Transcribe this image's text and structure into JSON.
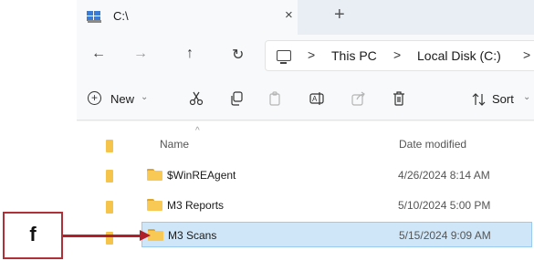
{
  "window": {
    "tab_title": "C:\\",
    "tab_close": "×",
    "new_tab": "+"
  },
  "nav": {
    "back": "←",
    "forward": "→",
    "up": "↑",
    "refresh": "↻",
    "breadcrumbs": [
      "This PC",
      "Local Disk (C:)"
    ],
    "separator": ">"
  },
  "toolbar": {
    "new_label": "New",
    "sort_label": "Sort",
    "icons": [
      "cut-icon",
      "copy-icon",
      "paste-icon",
      "rename-icon",
      "share-icon",
      "delete-icon",
      "sort-icon"
    ]
  },
  "file_list": {
    "columns": {
      "name": "Name",
      "date": "Date modified"
    },
    "rows": [
      {
        "name": "$WinREAgent",
        "date": "4/26/2024 8:14 AM",
        "selected": false
      },
      {
        "name": "M3 Reports",
        "date": "5/10/2024 5:00 PM",
        "selected": false
      },
      {
        "name": "M3 Scans",
        "date": "5/15/2024 9:09 AM",
        "selected": true
      }
    ]
  },
  "callout": {
    "label": "f",
    "color": "#b0202a"
  },
  "colors": {
    "selection_bg": "#cfe6f8",
    "selection_border": "#99cbee",
    "folder": "#f8c955"
  }
}
